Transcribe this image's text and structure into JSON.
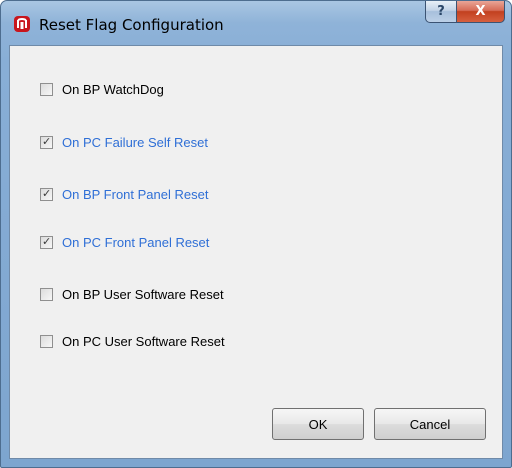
{
  "window": {
    "title": "Reset Flag Configuration",
    "help_label": "?",
    "close_label": "X"
  },
  "options": [
    {
      "label": "On BP WatchDog",
      "checked": false
    },
    {
      "label": "On PC Failure Self Reset",
      "checked": true
    },
    {
      "label": "On BP Front Panel Reset",
      "checked": true
    },
    {
      "label": "On PC Front Panel Reset",
      "checked": true
    },
    {
      "label": "On BP User Software Reset",
      "checked": false
    },
    {
      "label": "On PC User Software Reset",
      "checked": false
    }
  ],
  "buttons": {
    "ok_label": "OK",
    "cancel_label": "Cancel"
  },
  "colors": {
    "checked_label": "#2f6fd6",
    "app_icon": "#c8161d"
  },
  "icons": {
    "app": "app-logo-icon",
    "help": "help-icon",
    "close": "close-icon",
    "check": "checkmark-icon"
  }
}
